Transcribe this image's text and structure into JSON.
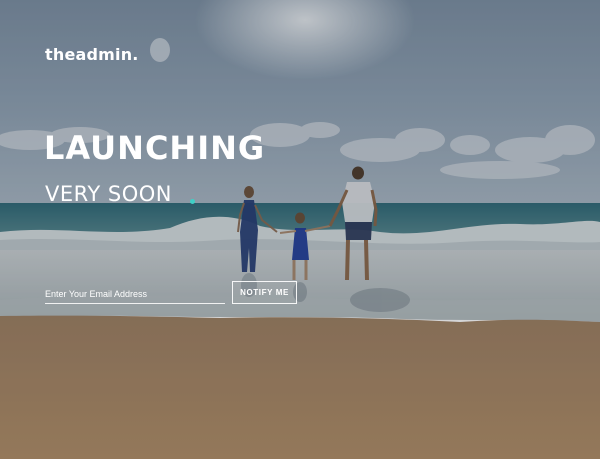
{
  "brand": {
    "logo_text": "theadmin."
  },
  "hero": {
    "title": "LAUNCHING",
    "subtitle": "VERY SOON",
    "accent_color": "#3fd0c6"
  },
  "signup": {
    "email_placeholder": "Enter Your Email Address",
    "email_value": "",
    "notify_label": "NOTIFY ME"
  }
}
